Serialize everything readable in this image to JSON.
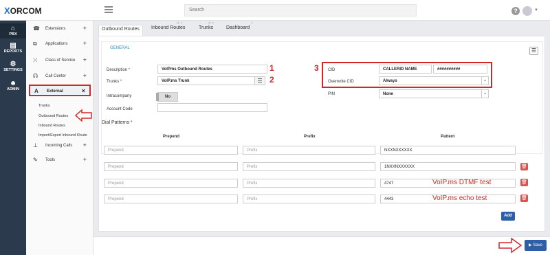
{
  "app": {
    "logo_x": "X",
    "logo_rest": "ORCOM"
  },
  "search": {
    "placeholder": "Search"
  },
  "rail": [
    {
      "icon": "⌂",
      "label": "PBX"
    },
    {
      "icon": "▤",
      "label": "REPORTS"
    },
    {
      "icon": "⚙",
      "label": "SETTINGS"
    },
    {
      "icon": "☻",
      "label": "ADMIN"
    }
  ],
  "nav": {
    "items": [
      {
        "icon": "☎",
        "label": "Extensions",
        "ctrl": "+"
      },
      {
        "icon": "⧉",
        "label": "Applications",
        "ctrl": "+"
      },
      {
        "icon": "⤫",
        "label": "Class of Service",
        "ctrl": "+"
      },
      {
        "icon": "☊",
        "label": "Call Center",
        "ctrl": "+"
      },
      {
        "icon": "A",
        "label": "External",
        "ctrl": "×"
      },
      {
        "icon": "⊥",
        "label": "Incoming Calls",
        "ctrl": "+"
      },
      {
        "icon": "✎",
        "label": "Tools",
        "ctrl": "+"
      }
    ],
    "subitems": [
      "Trunks",
      "Outbound Routes",
      "Inbound Routes",
      "Import/Export Inbound Route"
    ]
  },
  "tabs": [
    {
      "label": "Outbound Routes"
    },
    {
      "label": "Inbound Routes"
    },
    {
      "label": "Trunks"
    },
    {
      "label": "Dashboard"
    }
  ],
  "form": {
    "section": "GENERAL",
    "description_label": "Description",
    "description_value": "VoIPms Outbound Routes",
    "trunks_label": "Trunks",
    "trunks_value": "VoIP.ms Trunk",
    "intracompany_label": "Intracompany",
    "intracompany_value": "No",
    "account_code_label": "Account Code",
    "account_code_value": "",
    "cid_label": "CID",
    "cid_name": "CALLERID NAME",
    "cid_number": "##########",
    "overwrite_cid_label": "Overwrite CID",
    "overwrite_cid_value": "Always",
    "pin_label": "PIN",
    "pin_value": "None",
    "required_mark": "*"
  },
  "annotations": {
    "n1": "1",
    "n2": "2",
    "n3": "3",
    "note_dtmf": "VoIP.ms DTMF test",
    "note_echo": "VoIP.ms echo test"
  },
  "dial_patterns": {
    "title": "Dial Patterns",
    "columns": [
      "Prepend",
      "Prefix",
      "Pattern"
    ],
    "placeholders": {
      "prepend": "Prepend",
      "prefix": "Prefix"
    },
    "rows": [
      {
        "pattern": "NXXNXXXXXX"
      },
      {
        "pattern": "1NXXNXXXXXX"
      },
      {
        "pattern": "4747"
      },
      {
        "pattern": "4443"
      }
    ],
    "add_label": "Add"
  },
  "footer": {
    "save_label": "Save"
  }
}
